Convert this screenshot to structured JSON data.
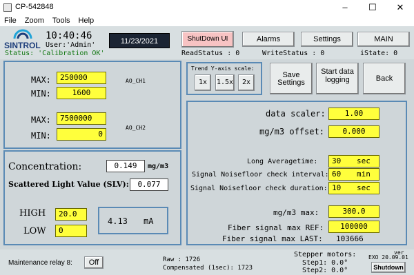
{
  "window": {
    "title": "CP-542848",
    "minimize": "–",
    "maximize": "☐",
    "close": "✕"
  },
  "menu": [
    "File",
    "Zoom",
    "Tools",
    "Help"
  ],
  "header": {
    "logo": "SINTROL",
    "time": "10:40:46",
    "user": "User:'Admin'",
    "status": "Status: 'Calibration OK'",
    "date": "11/23/2021",
    "shutdown_ui": "ShutDown UI",
    "alarms": "Alarms",
    "settings": "Settings",
    "main": "MAIN",
    "read_status": "ReadStatus : 0",
    "write_status": "WriteStatus : 0",
    "istate": "iState: 0"
  },
  "ao": {
    "ch1": {
      "max_label": "MAX:",
      "max": "250000",
      "min_label": "MIN:",
      "min": "1600",
      "name": "AO_CH1"
    },
    "ch2": {
      "max_label": "MAX:",
      "max": "7500000",
      "min_label": "MIN:",
      "min": "0",
      "name": "AO_CH2"
    }
  },
  "trend": {
    "title": "Trend Y-axis scale:",
    "b1": "1x",
    "b2": "1.5x",
    "b3": "2x"
  },
  "actions": {
    "save": "Save Settings",
    "start": "Start data logging",
    "back": "Back"
  },
  "params": {
    "data_scaler": {
      "label": "data scaler:",
      "value": "1.00"
    },
    "offset": {
      "label": "mg/m3 offset:",
      "value": "0.000"
    },
    "long_avg": {
      "label": "Long Averagetime:",
      "value": "30",
      "unit": "sec"
    },
    "noise_interval": {
      "label": "Signal Noisefloor check interval:",
      "value": "60",
      "unit": "min"
    },
    "noise_duration": {
      "label": "Signal Noisefloor check duration:",
      "value": "10",
      "unit": "sec"
    },
    "max": {
      "label": "mg/m3 max:",
      "value": "300.0"
    },
    "fiber_ref": {
      "label": "Fiber signal max REF:",
      "value": "100000"
    },
    "fiber_last": {
      "label": "Fiber signal max LAST:",
      "value": "103666"
    }
  },
  "measure": {
    "conc_label": "Concentration:",
    "conc": "0.149",
    "conc_unit": "mg/m3",
    "slv_label": "Scattered Light Value (SLV):",
    "slv": "0.077",
    "high_label": "HIGH",
    "high": "20.0",
    "low_label": "LOW",
    "low": "0",
    "ma": "4.13",
    "ma_unit": "mA"
  },
  "footer": {
    "relay_label": "Maintenance relay 8:",
    "relay_btn": "Off",
    "raw": "Raw : 1726",
    "compensated": "Compensated (1sec): 1723",
    "stepper": "Stepper motors:",
    "step1": "Step1: 0.0°",
    "step2": "Step2: 0.0°",
    "ver_label": "ver",
    "ver": "EXO 20.09.01",
    "shutdown": "Shutdown"
  }
}
